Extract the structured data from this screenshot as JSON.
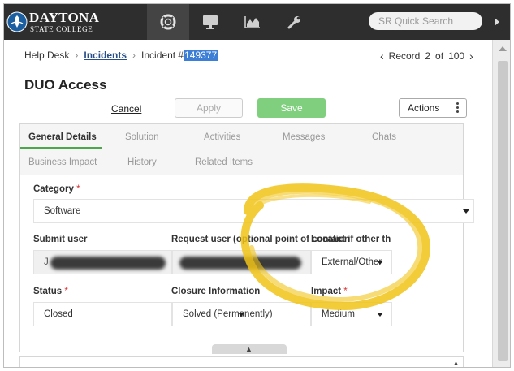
{
  "logo": {
    "line1": "DAYTONA",
    "line2": "STATE COLLEGE"
  },
  "topnav": {
    "icons": [
      "lifebuoy-icon",
      "monitor-icon",
      "area-chart-icon",
      "wrench-icon"
    ],
    "search_placeholder": "SR Quick Search"
  },
  "breadcrumb": {
    "root": "Help Desk",
    "section": "Incidents",
    "current_prefix": "Incident #",
    "current_id": "149377"
  },
  "record": {
    "label": "Record",
    "current": "2",
    "of": "of",
    "total": "100"
  },
  "page": {
    "title": "DUO Access"
  },
  "actions": {
    "cancel": "Cancel",
    "apply": "Apply",
    "save": "Save",
    "more": "Actions"
  },
  "tabs": {
    "row1": [
      "General Details",
      "Solution",
      "Activities",
      "Messages",
      "Chats"
    ],
    "row2": [
      "Business Impact",
      "History",
      "Related Items"
    ]
  },
  "form": {
    "category": {
      "label": "Category",
      "required": "*",
      "value": "Software"
    },
    "submit_user": {
      "label": "Submit user"
    },
    "request_user": {
      "label": "Request user (optional point of contact if other th...",
      "location_label": "Location"
    },
    "location": {
      "value": "External/Other"
    },
    "status": {
      "label": "Status",
      "required": "*",
      "value": "Closed"
    },
    "closure": {
      "label": "Closure Information",
      "value": "Solved (Permanently)"
    },
    "impact": {
      "label": "Impact",
      "required": "*",
      "value": "Medium"
    }
  },
  "colors": {
    "topbar": "#2e2e2e",
    "save": "#7fcf7f",
    "tab_active": "#4ca64c",
    "link": "#2a4f88",
    "highlight": "#3d7ed6",
    "annotation": "#f2c418"
  }
}
